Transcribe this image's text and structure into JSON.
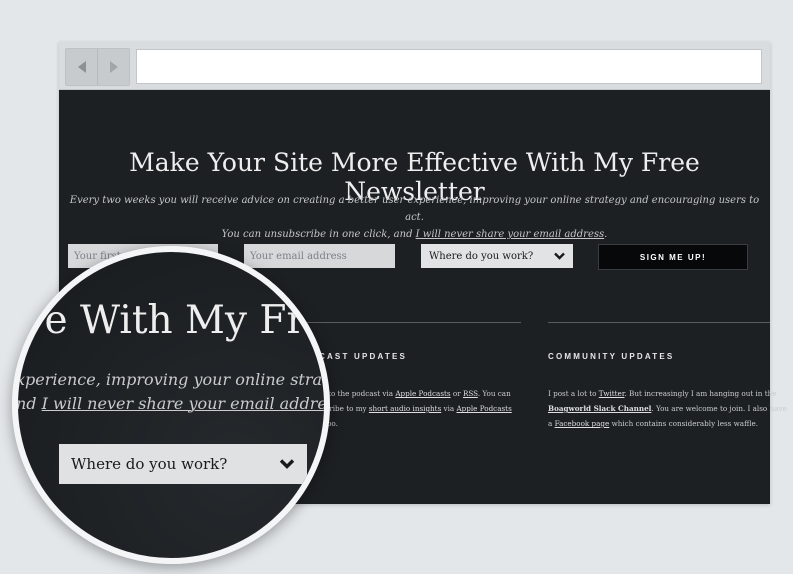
{
  "hero": {
    "title": "Make Your Site More Effective With My Free Newsletter",
    "intro_line1": "Every two weeks you will receive advice on creating a better user experience, improving your online strategy and encouraging users to act.",
    "intro_line2_prefix": "You can unsubscribe in one click, and ",
    "intro_line2_link": "I will never share your email address",
    "intro_line2_suffix": "."
  },
  "form": {
    "first_name_placeholder": "Your first name",
    "first_name_value": "",
    "email_placeholder": "Your email address",
    "email_value": "",
    "workplace_selected": "Where do you work?",
    "submit_label": "SIGN ME UP!"
  },
  "podcast": {
    "heading_visible": "DCAST UPDATES",
    "l1_a": "be to the podcast via ",
    "l1_link1": "Apple Podcasts",
    "l1_b": " or ",
    "l1_link2": "RSS",
    "l1_c": ". You can",
    "l2_a": "bscribe to my ",
    "l2_link1": "short audio insights",
    "l2_b": " via ",
    "l2_link2": "Apple Podcasts",
    "l3": "S too."
  },
  "community": {
    "heading": "COMMUNITY UPDATES",
    "l1_a": "I post a lot to ",
    "l1_link": "Twitter",
    "l1_b": ". But increasingly I am hanging out in the",
    "l2_bold": "Boagworld Slack Channel",
    "l2_b": ". You are welcome to join. I also have",
    "l3_a": "a ",
    "l3_link": "Facebook page",
    "l3_b": " which contains considerably less waffle."
  },
  "magnifier": {
    "title_fragment": "ive With My Fr",
    "line1": "xperience, improving your online strategy a",
    "line2_prefix": "nd ",
    "line2_link": "I will never share your email address",
    "line2_suffix": ".",
    "select_label": "Where do you work?"
  },
  "icons": {
    "back": "arrow-left-icon",
    "forward": "arrow-right-icon",
    "dropdown": "chevron-down-icon"
  },
  "colors": {
    "page_background": "#e3e7ea",
    "site_background": "#1d2023",
    "button_background": "#07080a",
    "field_background": "#d6d8da"
  }
}
